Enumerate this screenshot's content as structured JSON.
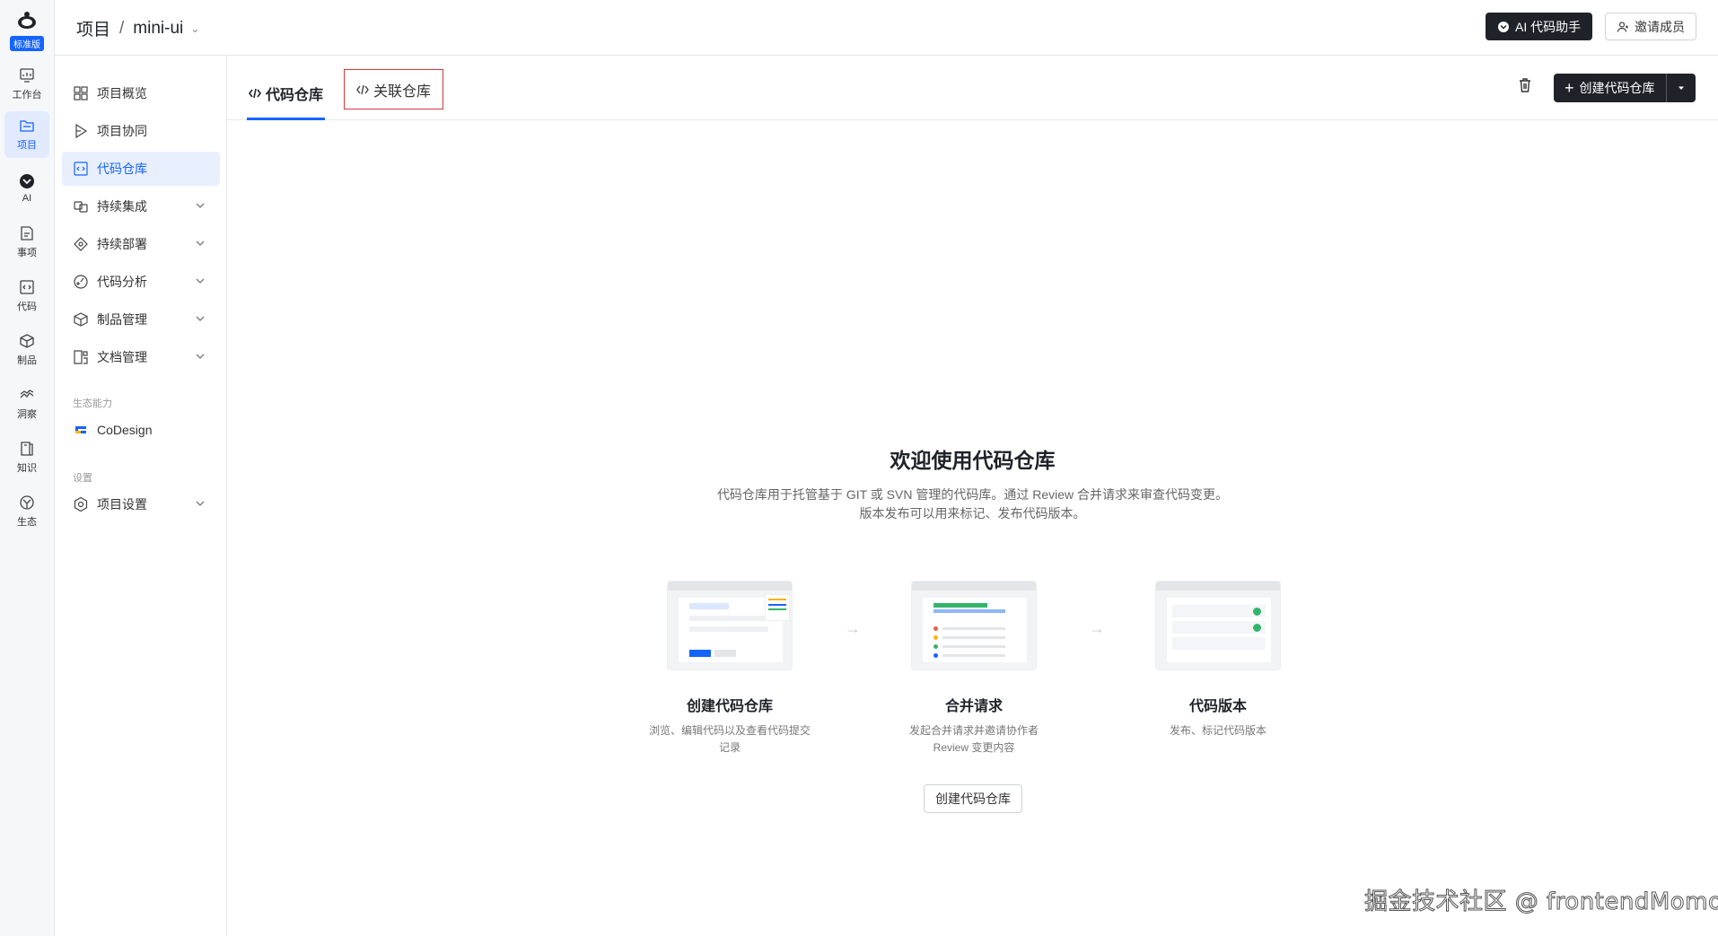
{
  "rail": {
    "logo_badge": "标准版",
    "items": [
      {
        "label": "工作台",
        "icon": "dashboard-icon"
      },
      {
        "label": "项目",
        "icon": "folder-icon"
      },
      {
        "label": "AI",
        "icon": "ai-icon"
      },
      {
        "label": "事项",
        "icon": "task-icon"
      },
      {
        "label": "代码",
        "icon": "code-icon"
      },
      {
        "label": "制品",
        "icon": "box-icon"
      },
      {
        "label": "洞察",
        "icon": "insight-icon"
      },
      {
        "label": "知识",
        "icon": "book-icon"
      },
      {
        "label": "生态",
        "icon": "ecosystem-icon"
      }
    ],
    "active": "项目"
  },
  "topbar": {
    "breadcrumb_root": "项目",
    "breadcrumb_sep": "/",
    "project_name": "mini-ui",
    "ai_button": "AI 代码助手",
    "invite_button": "邀请成员"
  },
  "sidebar": {
    "items": [
      {
        "label": "项目概览",
        "icon": "grid-icon"
      },
      {
        "label": "项目协同",
        "icon": "play-icon"
      },
      {
        "label": "代码仓库",
        "icon": "code-icon"
      },
      {
        "label": "持续集成",
        "icon": "ci-icon"
      },
      {
        "label": "持续部署",
        "icon": "deploy-icon"
      },
      {
        "label": "代码分析",
        "icon": "analysis-icon"
      },
      {
        "label": "制品管理",
        "icon": "box-icon"
      },
      {
        "label": "文档管理",
        "icon": "doc-icon"
      }
    ],
    "active": "代码仓库",
    "section_ecosystem": "生态能力",
    "ecosystem_item": "CoDesign",
    "section_settings": "设置",
    "settings_item": "项目设置"
  },
  "main": {
    "tab_active": "代码仓库",
    "tab_linked": "关联仓库",
    "create_button": "创建代码仓库",
    "welcome_title": "欢迎使用代码仓库",
    "welcome_desc_line1": "代码仓库用于托管基于 GIT 或 SVN 管理的代码库。通过 Review 合并请求来审查代码变更。",
    "welcome_desc_line2": "版本发布可以用来标记、发布代码版本。",
    "steps": [
      {
        "title": "创建代码仓库",
        "desc_line1": "浏览、编辑代码以及查看代码提交",
        "desc_line2": "记录"
      },
      {
        "title": "合并请求",
        "desc_line1": "发起合并请求并邀请协作者",
        "desc_line2": "Review 变更内容"
      },
      {
        "title": "代码版本",
        "desc_line1": "发布、标记代码版本",
        "desc_line2": ""
      }
    ],
    "cta_button": "创建代码仓库"
  },
  "watermark": "掘金技术社区 @ frontendMomo",
  "colors": {
    "accent": "#1664ff",
    "dark_button": "#1f2329",
    "highlight_border": "#d9363e"
  }
}
